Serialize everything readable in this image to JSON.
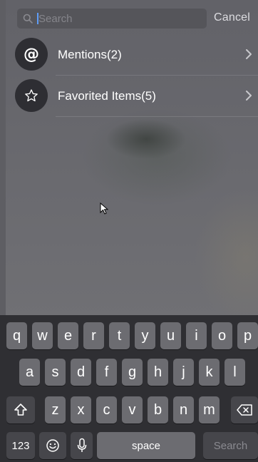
{
  "search": {
    "placeholder": "Search",
    "value": "",
    "cancel_label": "Cancel"
  },
  "list": [
    {
      "icon": "at-sign-icon",
      "label": "Mentions(2)"
    },
    {
      "icon": "star-icon",
      "label": "Favorited Items(5)"
    }
  ],
  "keyboard": {
    "row1": [
      "q",
      "w",
      "e",
      "r",
      "t",
      "y",
      "u",
      "i",
      "o",
      "p"
    ],
    "row2": [
      "a",
      "s",
      "d",
      "f",
      "g",
      "h",
      "j",
      "k",
      "l"
    ],
    "row3": [
      "z",
      "x",
      "c",
      "v",
      "b",
      "n",
      "m"
    ],
    "shift_icon": "shift-icon",
    "delete_icon": "backspace-icon",
    "numbers_label": "123",
    "emoji_icon": "emoji-icon",
    "mic_icon": "microphone-icon",
    "space_label": "space",
    "search_label": "Search"
  }
}
